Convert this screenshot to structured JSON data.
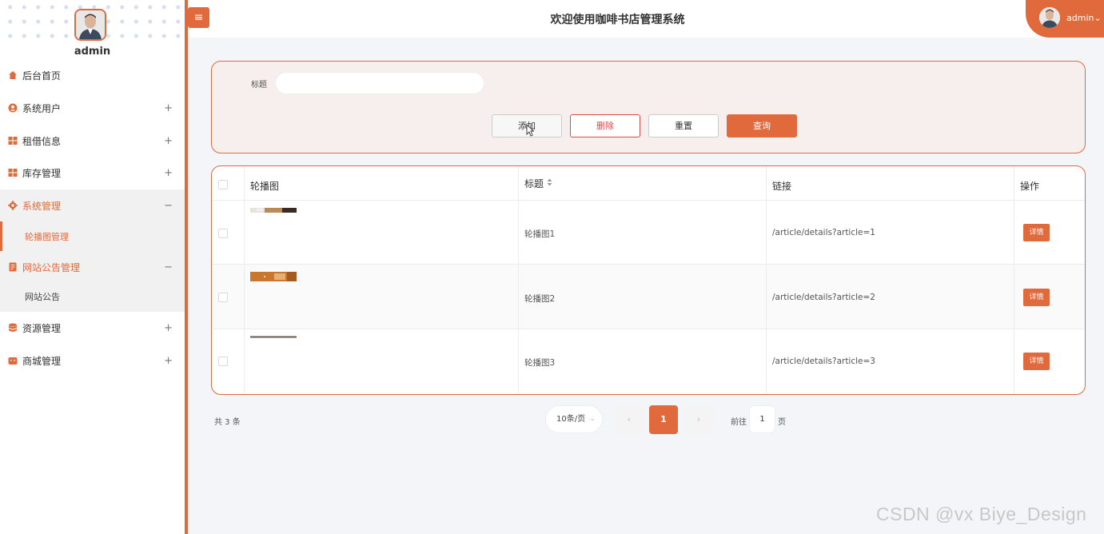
{
  "app": {
    "title": "欢迎使用咖啡书店管理系统",
    "menu_toggle": "≡"
  },
  "user": {
    "sidebar_name": "admin",
    "header_name": "admin",
    "header_caret": "⌄"
  },
  "sidebar": {
    "items": [
      {
        "label": "后台首页",
        "icon": "home-icon",
        "toggle": ""
      },
      {
        "label": "系统用户",
        "icon": "user-icon",
        "toggle": "+"
      },
      {
        "label": "租借信息",
        "icon": "grid-icon",
        "toggle": "+"
      },
      {
        "label": "库存管理",
        "icon": "grid-icon",
        "toggle": "+"
      },
      {
        "label": "系统管理",
        "icon": "gear-icon",
        "toggle": "−"
      },
      {
        "label": "网站公告管理",
        "icon": "document-icon",
        "toggle": "−"
      },
      {
        "label": "资源管理",
        "icon": "database-icon",
        "toggle": "+"
      },
      {
        "label": "商城管理",
        "icon": "shop-icon",
        "toggle": "+"
      }
    ],
    "subitems": [
      {
        "label": "轮播图管理",
        "active": true
      },
      {
        "label": "网站公告",
        "active": false
      }
    ]
  },
  "search": {
    "label": "标题",
    "value": "",
    "buttons": {
      "add": "添加",
      "delete": "删除",
      "reset": "重置",
      "query": "查询"
    }
  },
  "table": {
    "columns": [
      "轮播图",
      "标题",
      "链接",
      "操作"
    ],
    "rows": [
      {
        "title": "轮播图1",
        "link": "/article/details?article=1",
        "action": "详情"
      },
      {
        "title": "轮播图2",
        "link": "/article/details?article=2",
        "action": "详情"
      },
      {
        "title": "轮播图3",
        "link": "/article/details?article=3",
        "action": "详情"
      }
    ]
  },
  "pagination": {
    "total_text": "共 3 条",
    "page_size": "10条/页",
    "current_page": "1",
    "goto_label": "前往",
    "goto_value": "1",
    "goto_unit": "页",
    "prev": "‹",
    "next": "›"
  },
  "watermark": "CSDN @vx Biye_Design",
  "colors": {
    "accent": "#e06a3b",
    "danger": "#e24a4a"
  }
}
